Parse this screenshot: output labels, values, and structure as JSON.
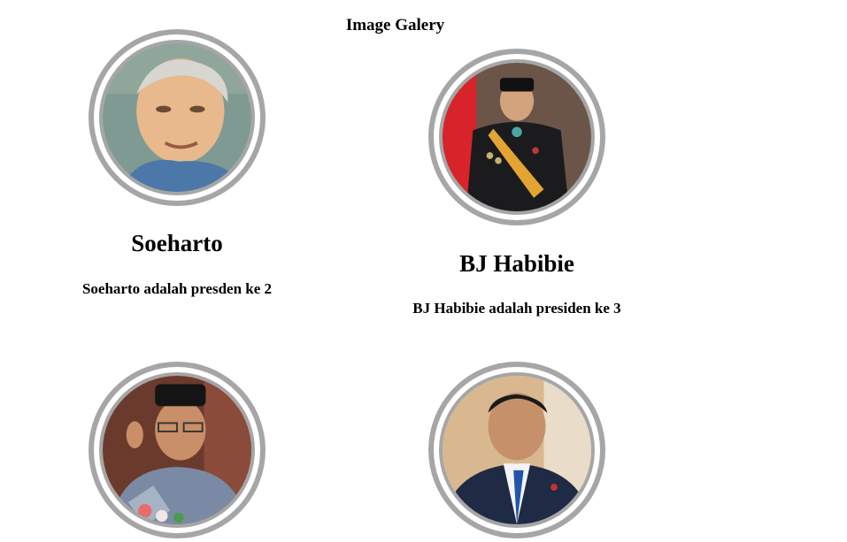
{
  "gallery": {
    "title": "Image Galery"
  },
  "items": [
    {
      "name": "Soeharto",
      "description": "Soeharto adalah presden ke 2",
      "portrait": "portrait-soeharto"
    },
    {
      "name": "BJ Habibie",
      "description": "BJ Habibie adalah presiden ke 3",
      "portrait": "portrait-habibie"
    },
    {
      "name": "",
      "description": "",
      "portrait": "portrait-gus-dur"
    },
    {
      "name": "",
      "description": "",
      "portrait": "portrait-sby"
    }
  ],
  "colors": {
    "frame_ring": "#a6a6a6",
    "background": "#ffffff",
    "text": "#000000"
  }
}
